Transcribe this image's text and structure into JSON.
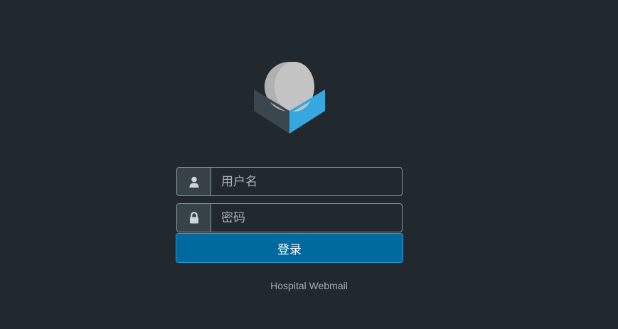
{
  "login": {
    "username_placeholder": "用户名",
    "password_placeholder": "密码",
    "submit_label": "登录"
  },
  "footer": {
    "product_name": "Hospital Webmail"
  },
  "icons": {
    "logo": "roundcube-logo",
    "user": "user-icon",
    "lock": "lock-icon"
  },
  "colors": {
    "background": "#21292e",
    "accent": "#37a7e0",
    "button": "#006a9e"
  }
}
